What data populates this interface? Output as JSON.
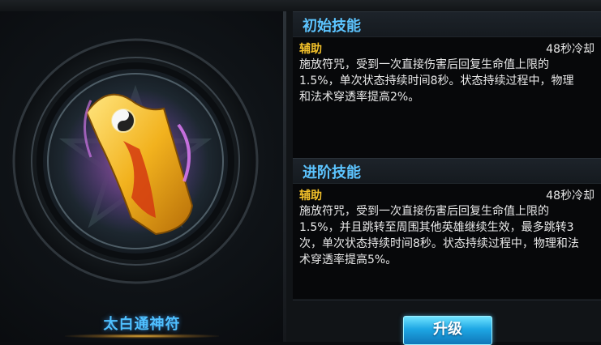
{
  "item": {
    "name": "太白通神符"
  },
  "initial_skill": {
    "header": "初始技能",
    "type": "辅助",
    "cooldown": "48秒冷却",
    "description": "施放符咒，受到一次直接伤害后回复生命值上限的1.5%，单次状态持续时间8秒。状态持续过程中，物理和法术穿透率提高2%。"
  },
  "advanced_skill": {
    "header": "进阶技能",
    "type": "辅助",
    "cooldown": "48秒冷却",
    "description": "施放符咒，受到一次直接伤害后回复生命值上限的1.5%，并且跳转至周围其他英雄继续生效，最多跳转3次，单次状态持续时间8秒。状态持续过程中，物理和法术穿透率提高5%。"
  },
  "actions": {
    "upgrade_label": "升级"
  },
  "colors": {
    "header_text": "#5cc4ff",
    "skill_type": "#f3c12a",
    "item_name": "#4fc0ff",
    "button": "#1ea7e4"
  }
}
